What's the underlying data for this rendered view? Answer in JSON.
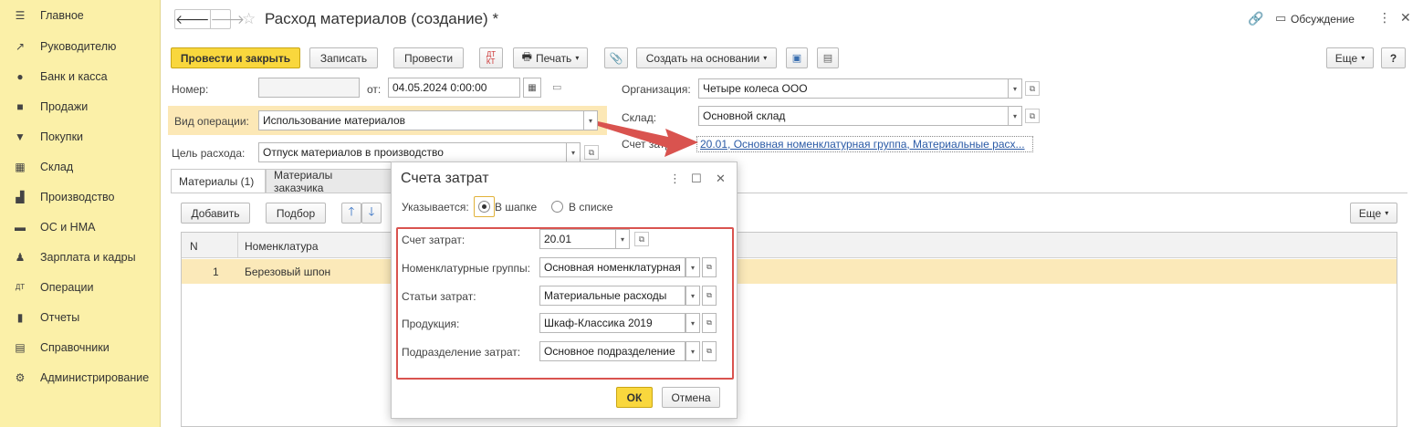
{
  "sidebar": {
    "items": [
      {
        "label": "Главное",
        "icon": "menu-icon"
      },
      {
        "label": "Руководителю",
        "icon": "trend-icon"
      },
      {
        "label": "Банк и касса",
        "icon": "coin-icon"
      },
      {
        "label": "Продажи",
        "icon": "bag-icon"
      },
      {
        "label": "Покупки",
        "icon": "cart-icon"
      },
      {
        "label": "Склад",
        "icon": "warehouse-icon"
      },
      {
        "label": "Производство",
        "icon": "factory-icon"
      },
      {
        "label": "ОС и НМА",
        "icon": "truck-icon"
      },
      {
        "label": "Зарплата и кадры",
        "icon": "person-icon"
      },
      {
        "label": "Операции",
        "icon": "dt-kt-icon"
      },
      {
        "label": "Отчеты",
        "icon": "chart-icon"
      },
      {
        "label": "Справочники",
        "icon": "book-icon"
      },
      {
        "label": "Администрирование",
        "icon": "gear-icon"
      }
    ]
  },
  "header": {
    "title": "Расход материалов (создание) *",
    "discuss": "Обсуждение"
  },
  "toolbar": {
    "post_close": "Провести и закрыть",
    "save": "Записать",
    "post": "Провести",
    "print": "Печать",
    "create_based": "Создать на основании",
    "more": "Еще",
    "help": "?"
  },
  "form": {
    "number_label": "Номер:",
    "number_value": "",
    "from_label": "от:",
    "date_value": "04.05.2024  0:00:00",
    "org_label": "Организация:",
    "org_value": "Четыре колеса ООО",
    "op_label": "Вид операции:",
    "op_value": "Использование материалов",
    "warehouse_label": "Склад:",
    "warehouse_value": "Основной склад",
    "purpose_label": "Цель расхода:",
    "purpose_value": "Отпуск материалов в производство",
    "account_label": "Счет затрат:",
    "account_link": "20.01, Основная номенклатурная группа, Материальные расх..."
  },
  "tabs": [
    {
      "label": "Материалы (1)"
    },
    {
      "label": "Материалы заказчика"
    }
  ],
  "table_toolbar": {
    "add": "Добавить",
    "select": "Подбор",
    "more": "Еще"
  },
  "table": {
    "columns": [
      "N",
      "Номенклатура"
    ],
    "rows": [
      {
        "n": "1",
        "item": "Березовый шпон"
      }
    ]
  },
  "dialog": {
    "title": "Счета затрат",
    "specified_label": "Указывается:",
    "radio_header": "В шапке",
    "radio_list": "В списке",
    "fields": [
      {
        "label": "Счет затрат:",
        "value": "20.01"
      },
      {
        "label": "Номенклатурные группы:",
        "value": "Основная номенклатурная"
      },
      {
        "label": "Статьи затрат:",
        "value": "Материальные расходы"
      },
      {
        "label": "Продукция:",
        "value": "Шкаф-Классика 2019"
      },
      {
        "label": "Подразделение затрат:",
        "value": "Основное подразделение"
      }
    ],
    "ok": "ОК",
    "cancel": "Отмена"
  },
  "colors": {
    "sidebar_bg": "#fbf0a8",
    "primary_button": "#f9d73d",
    "highlight_row": "#fbe9b9",
    "annotation_red": "#d9534f",
    "link": "#2a5aa6"
  }
}
